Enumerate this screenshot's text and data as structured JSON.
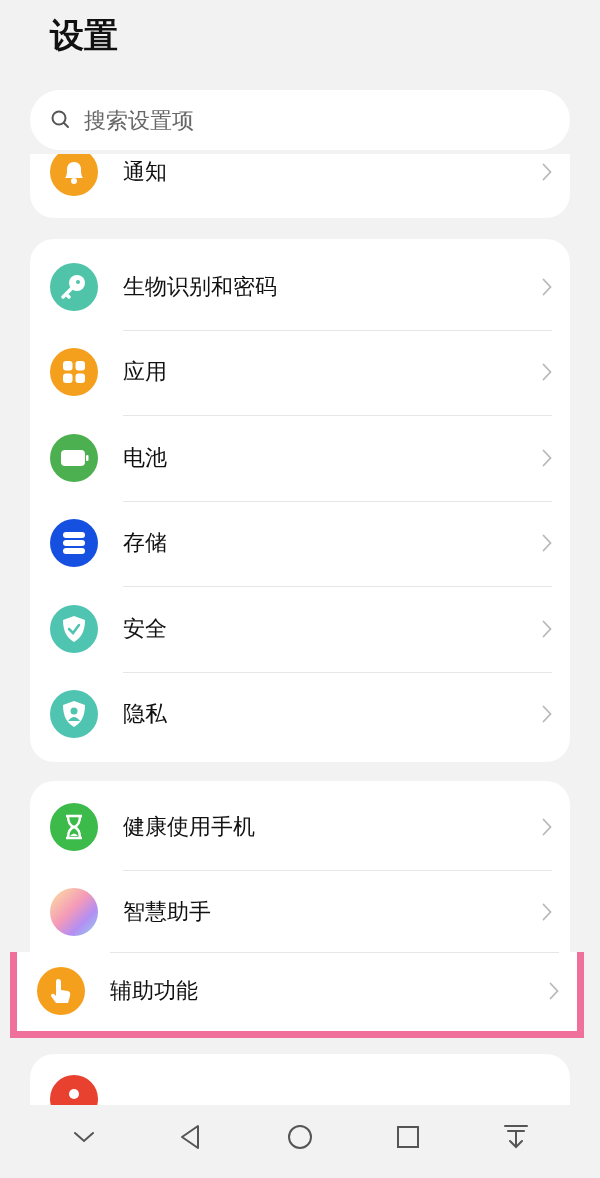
{
  "title": "设置",
  "search": {
    "placeholder": "搜索设置项"
  },
  "groups": [
    {
      "items": [
        {
          "kind": "bell",
          "label": "通知",
          "highlighted": false
        }
      ]
    },
    {
      "items": [
        {
          "kind": "key",
          "label": "生物识别和密码",
          "highlighted": false
        },
        {
          "kind": "apps",
          "label": "应用",
          "highlighted": false
        },
        {
          "kind": "battery",
          "label": "电池",
          "highlighted": false
        },
        {
          "kind": "storage",
          "label": "存储",
          "highlighted": false
        },
        {
          "kind": "shield",
          "label": "安全",
          "highlighted": false
        },
        {
          "kind": "privacy",
          "label": "隐私",
          "highlighted": false
        }
      ]
    },
    {
      "items": [
        {
          "kind": "hourglass",
          "label": "健康使用手机",
          "highlighted": false
        },
        {
          "kind": "assistant",
          "label": "智慧助手",
          "highlighted": false
        },
        {
          "kind": "hand",
          "label": "辅助功能",
          "highlighted": true
        }
      ]
    },
    {
      "items": [
        {
          "kind": "user"
        }
      ]
    }
  ],
  "nav": [
    {
      "kind": "down"
    },
    {
      "kind": "back"
    },
    {
      "kind": "home"
    },
    {
      "kind": "recent"
    },
    {
      "kind": "pulldown"
    }
  ]
}
